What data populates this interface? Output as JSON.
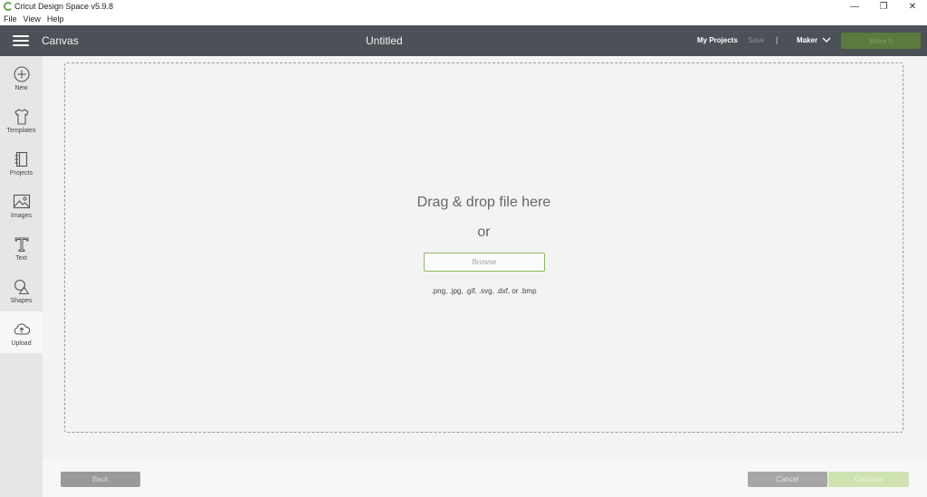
{
  "window": {
    "title": "Cricut Design Space  v5.9.8",
    "controls": [
      "—",
      "❐",
      "✕"
    ],
    "accent": "#5a7a3e"
  },
  "menu": [
    "File",
    "View",
    "Help"
  ],
  "header": {
    "section": "Canvas",
    "doc_title": "Untitled",
    "my_projects": "My Projects",
    "save": "Save",
    "separator": "|",
    "machine": "Maker",
    "make_it": "Make It"
  },
  "sidebar": {
    "items": [
      {
        "label": "New",
        "icon": "plus-circle-icon"
      },
      {
        "label": "Templates",
        "icon": "tshirt-icon"
      },
      {
        "label": "Projects",
        "icon": "notebook-icon"
      },
      {
        "label": "Images",
        "icon": "image-icon"
      },
      {
        "label": "Text",
        "icon": "text-t-icon"
      },
      {
        "label": "Shapes",
        "icon": "shapes-icon"
      },
      {
        "label": "Upload",
        "icon": "cloud-upload-icon"
      }
    ],
    "active": "Upload"
  },
  "dropzone": {
    "main_text": "Drag & drop file here",
    "or_text": "or",
    "browse": "Browse",
    "formats": ".png, .jpg, .gif, .svg, .dxf, or .bmp"
  },
  "footer": {
    "back": "Back",
    "cancel": "Cancel",
    "continue": "Continue"
  }
}
